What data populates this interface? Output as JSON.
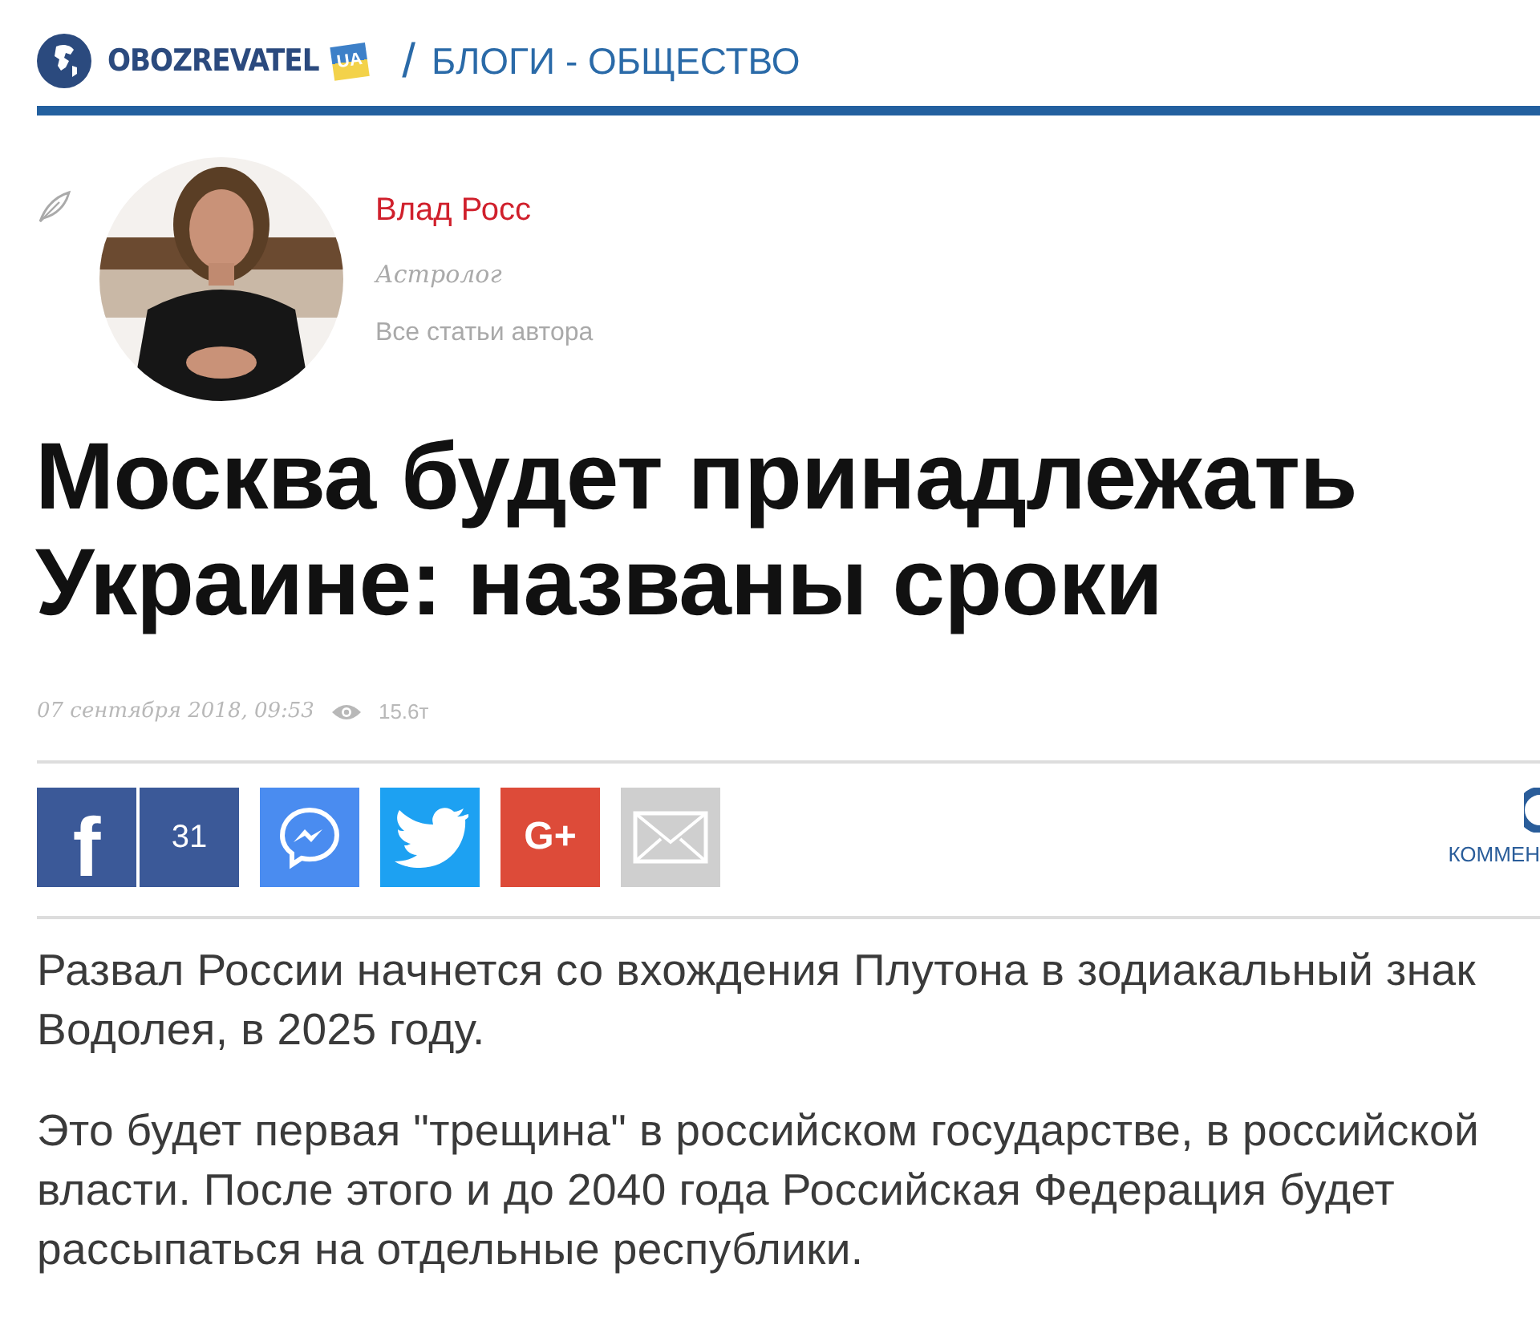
{
  "header": {
    "logo_text": "OBOZREVATEL",
    "logo_suffix": "UA",
    "separator": "/",
    "section": "БЛОГИ - ОБЩЕСТВО"
  },
  "author": {
    "name": "Влад Росс",
    "role": "Астролог",
    "all_articles": "Все статьи автора"
  },
  "article": {
    "title": "Москва будет принадлежать Украине: названы сроки",
    "date": "07 сентября 2018, 09:53",
    "views": "15.6т"
  },
  "share": [
    {
      "kind": "facebook",
      "label": "f",
      "count": "31"
    },
    {
      "kind": "messenger"
    },
    {
      "kind": "twitter"
    },
    {
      "kind": "googleplus",
      "label": "G+"
    },
    {
      "kind": "email"
    }
  ],
  "comments": {
    "label": "КОММЕН"
  },
  "paragraphs": [
    "Развал России начнется со вхождения Плутона в зодиакальный знак Водолея, в 2025 году.",
    "Это будет первая \"трещина\" в российском государстве, в российской власти. После этого и до 2040 года Российская Федерация будет рассыпаться на отдельные республики."
  ]
}
